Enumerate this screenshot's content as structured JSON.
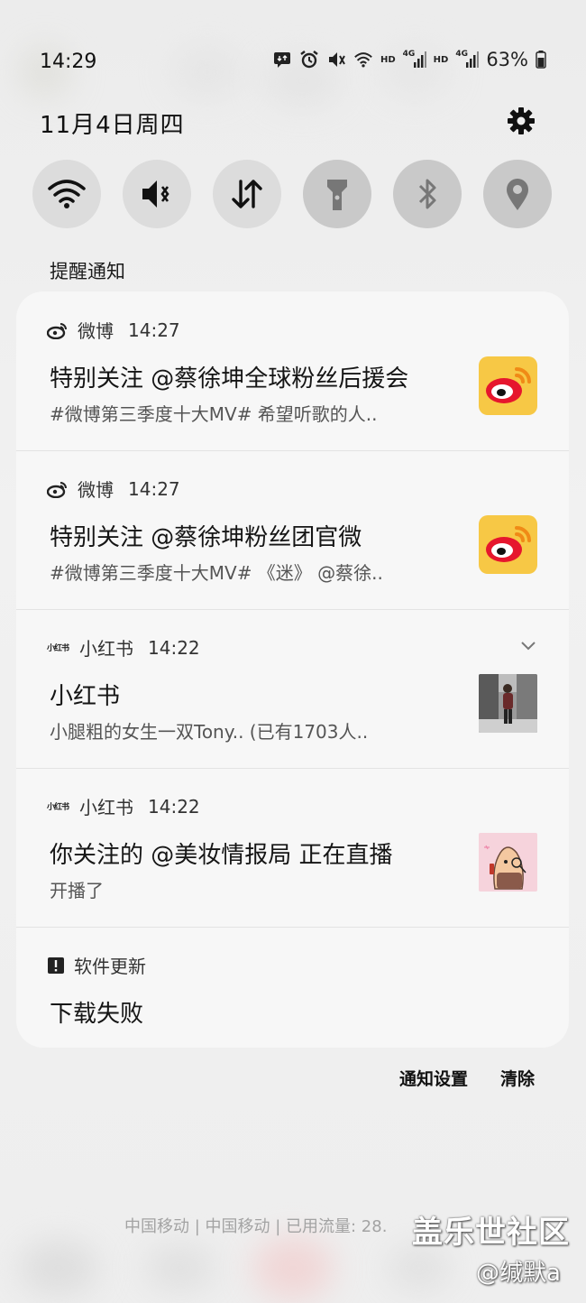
{
  "status_bar": {
    "time": "14:29",
    "hd1": "HD",
    "net1": "4G",
    "hd2": "HD",
    "net2": "4G",
    "battery": "63%"
  },
  "header": {
    "date": "11月4日周四"
  },
  "section": {
    "title": "提醒通知"
  },
  "notifications": [
    {
      "app": "微博",
      "time": "14:27",
      "title": "特别关注 @蔡徐坤全球粉丝后援会",
      "body": "#微博第三季度十大MV# 希望听歌的人..",
      "icon": "weibo-icon"
    },
    {
      "app": "微博",
      "time": "14:27",
      "title": "特别关注 @蔡徐坤粉丝团官微",
      "body": "#微博第三季度十大MV# 《迷》 @蔡徐..",
      "icon": "weibo-icon"
    },
    {
      "app": "小红书",
      "time": "14:22",
      "title": "小红书",
      "body": "小腿粗的女生一双Tony.. (已有1703人..",
      "icon": "xiaohongshu-icon",
      "logo_text": "小红书"
    },
    {
      "app": "小红书",
      "time": "14:22",
      "title": "你关注的 @美妆情报局 正在直播",
      "body": "开播了",
      "icon": "xiaohongshu-icon",
      "logo_text": "小红书"
    },
    {
      "app": "软件更新",
      "title": "下载失败",
      "icon": "alert-icon"
    }
  ],
  "footer": {
    "settings_label": "通知设置",
    "clear_label": "清除",
    "carrier": "中国移动 | 中国移动 | 已用流量: 28."
  },
  "watermark": {
    "site": "盖乐世社区",
    "user": "@缄默a"
  },
  "colors": {
    "weibo_yellow": "#f7c845",
    "weibo_red": "#e6162d",
    "card_bg": "#f7f7f7",
    "page_bg": "#efefef"
  }
}
